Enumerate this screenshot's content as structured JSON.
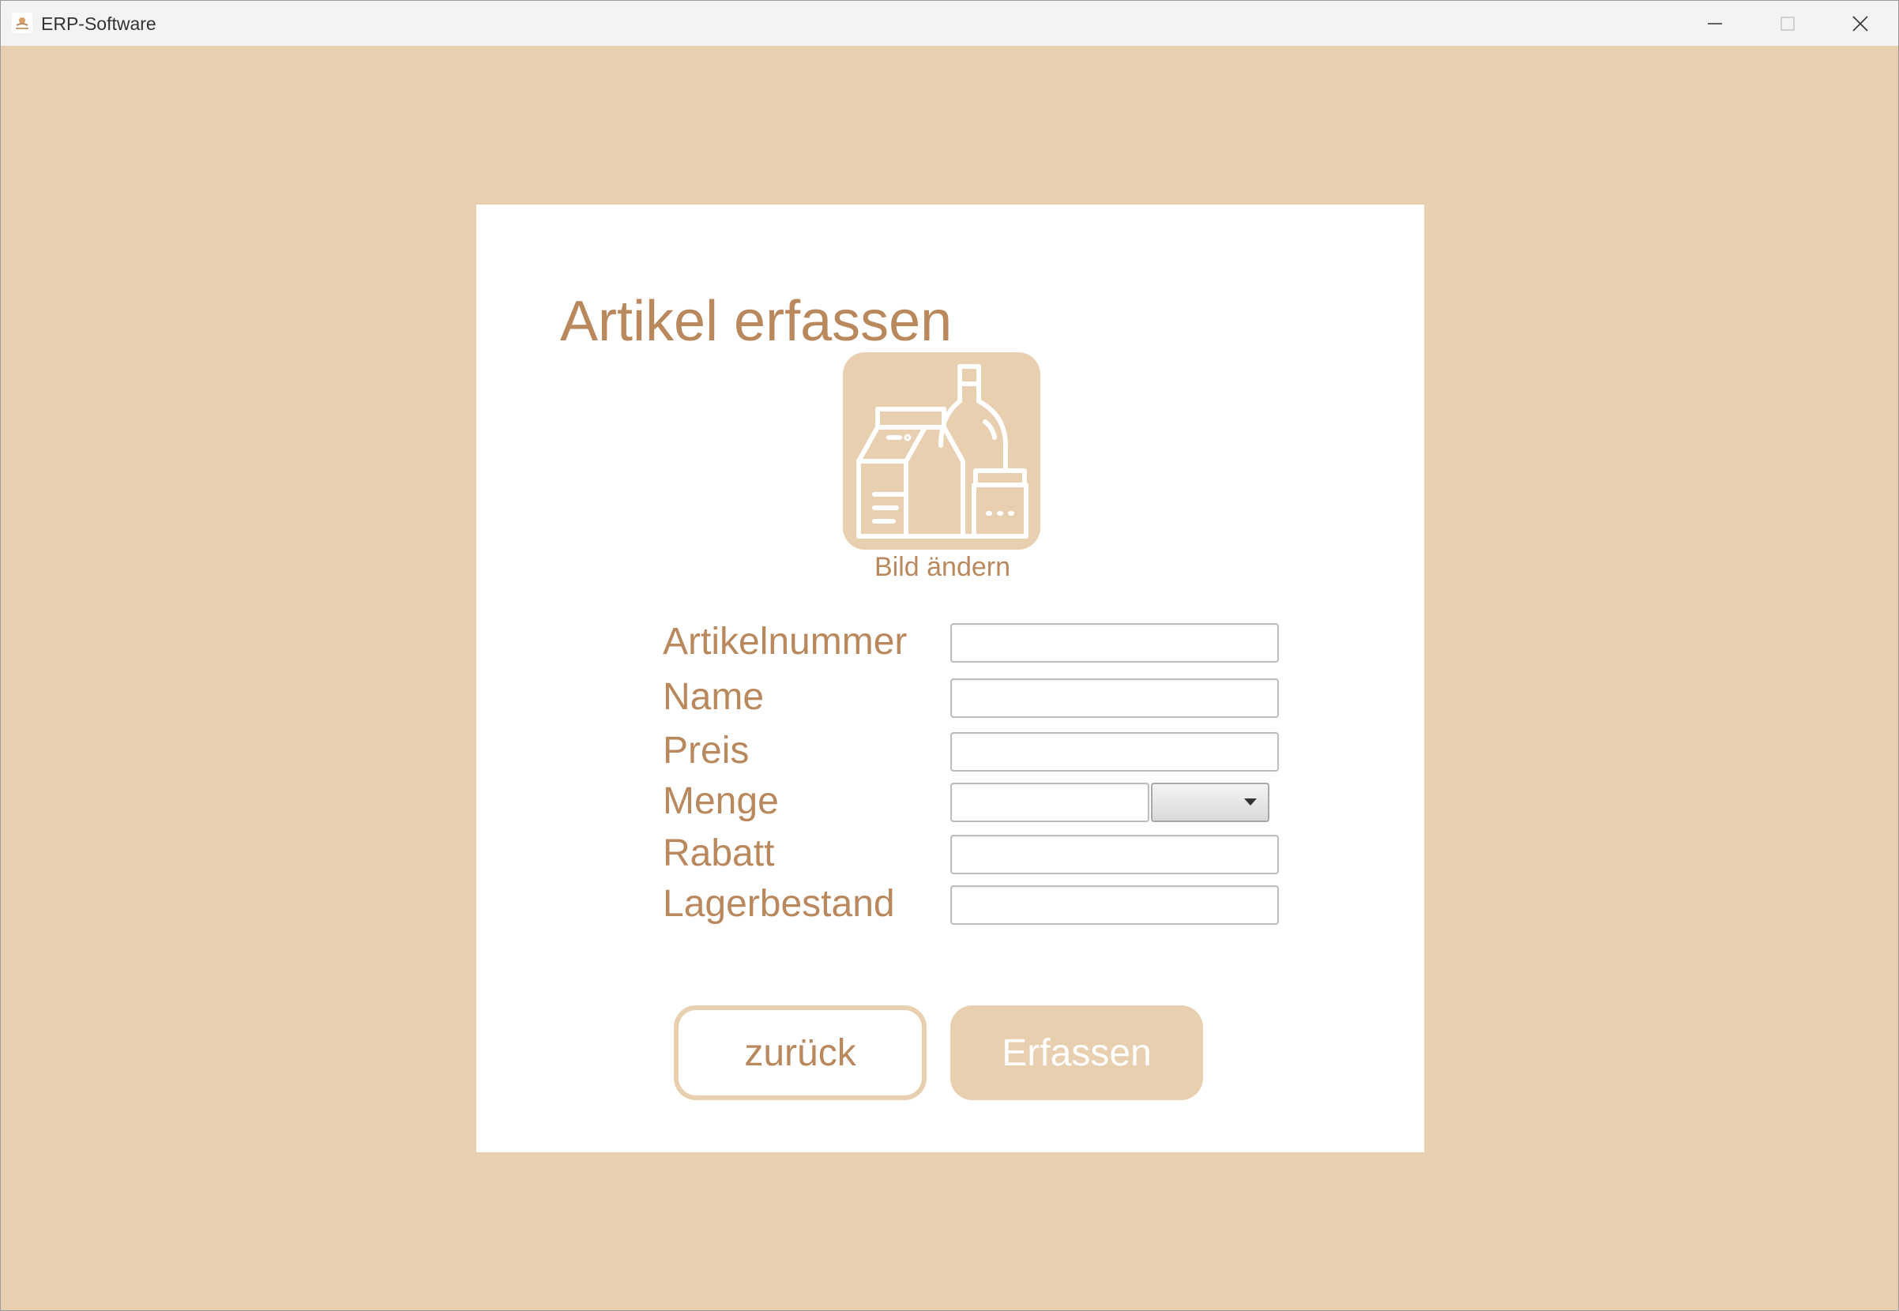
{
  "window": {
    "title": "ERP-Software",
    "controls": {
      "minimize_icon": "minimize-icon",
      "maximize_icon": "maximize-icon",
      "close_icon": "close-icon"
    }
  },
  "colors": {
    "background": "#e8cfb0",
    "accent": "#b9885d",
    "card": "#ffffff"
  },
  "form": {
    "title": "Artikel erfassen",
    "image_icon": "groceries-icon",
    "change_image_label": "Bild ändern",
    "fields": {
      "article_number": {
        "label": "Artikelnummer",
        "value": ""
      },
      "name": {
        "label": "Name",
        "value": ""
      },
      "price": {
        "label": "Preis",
        "value": ""
      },
      "quantity": {
        "label": "Menge",
        "value": "",
        "unit_selected": ""
      },
      "discount": {
        "label": "Rabatt",
        "value": ""
      },
      "stock": {
        "label": "Lagerbestand",
        "value": ""
      }
    },
    "buttons": {
      "back": "zurück",
      "submit": "Erfassen"
    }
  }
}
